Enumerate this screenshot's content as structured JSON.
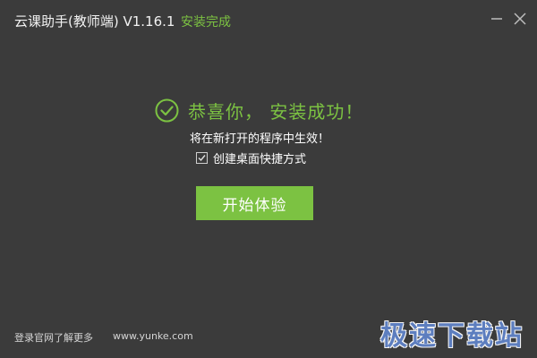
{
  "window": {
    "title": "云课助手(教师端) V1.16.1",
    "status": "安装完成",
    "minimize_icon": "minimize-icon",
    "close_icon": "close-icon"
  },
  "main": {
    "success_icon": "check-circle-icon",
    "success_message": "恭喜你， 安装成功！",
    "effect_note": "将在新打开的程序中生效！",
    "shortcut_checkbox": {
      "label": "创建桌面快捷方式",
      "checked": true
    },
    "start_button_label": "开始体验"
  },
  "footer": {
    "learn_more": "登录官网了解更多",
    "website": "www.yunke.com"
  },
  "watermark": "极速下载站",
  "colors": {
    "background": "#3b3b3b",
    "accent": "#7cc242",
    "watermark": "#5f82c7"
  }
}
